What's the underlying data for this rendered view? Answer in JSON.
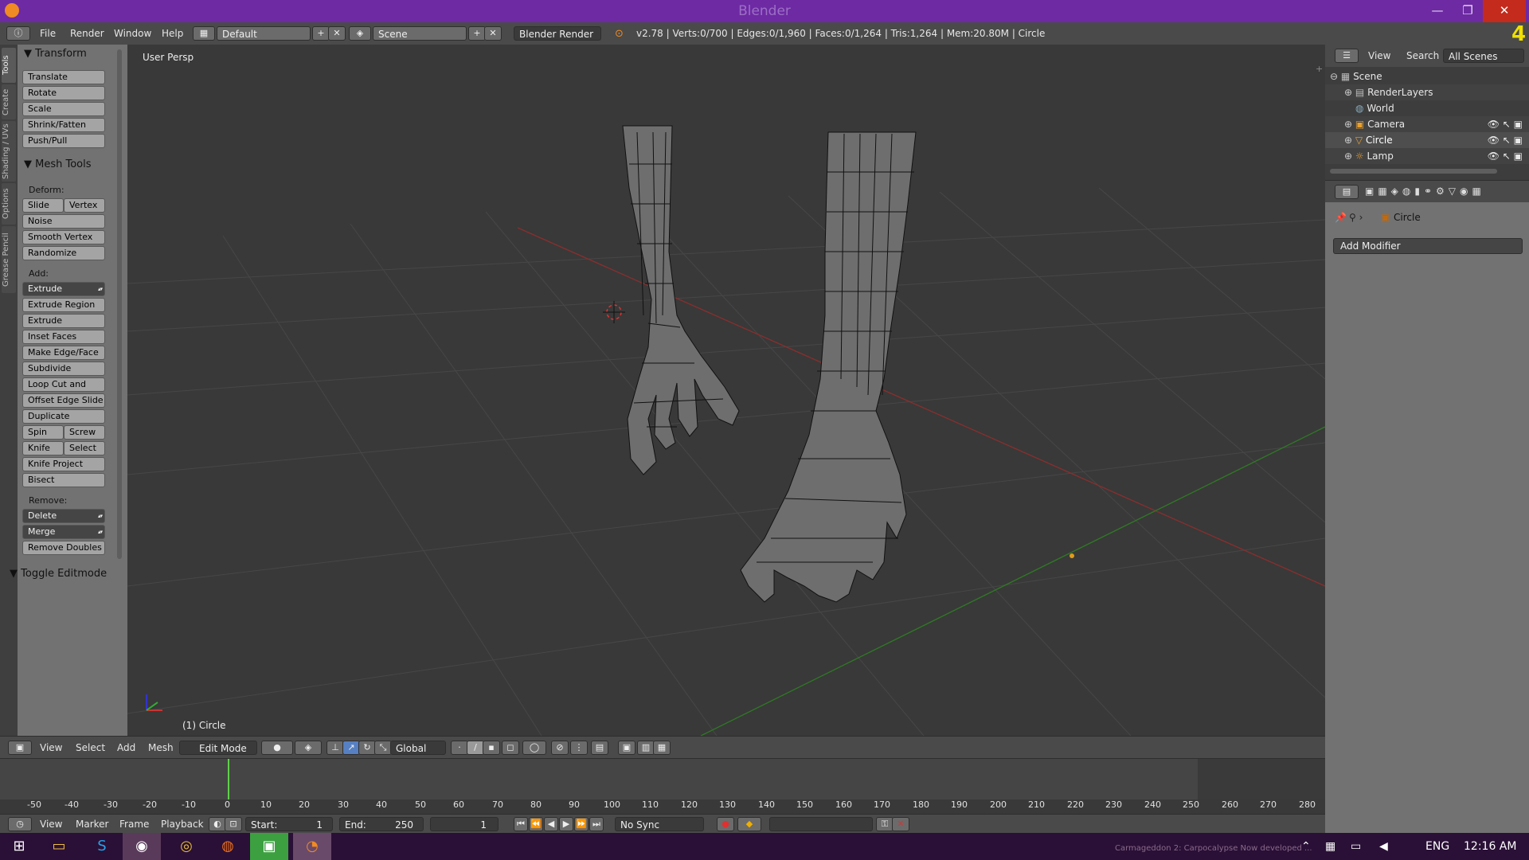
{
  "app": {
    "title": "Blender",
    "version_mark": "4",
    "minimize": "—",
    "maximize": "❐",
    "close": "✕"
  },
  "info_header": {
    "menus": [
      "File",
      "Render",
      "Window",
      "Help"
    ],
    "layout": "Default",
    "scene": "Scene",
    "engine": "Blender Render",
    "stats": "v2.78 | Verts:0/700 | Edges:0/1,960 | Faces:0/1,264 | Tris:1,264 | Mem:20.80M | Circle"
  },
  "vertical_tabs": [
    "Tools",
    "Create",
    "Shading / UVs",
    "Options",
    "Grease Pencil"
  ],
  "tool_shelf": {
    "transform": {
      "header": "Transform",
      "buttons": [
        "Translate",
        "Rotate",
        "Scale",
        "Shrink/Fatten",
        "Push/Pull"
      ]
    },
    "mesh_tools": {
      "header": "Mesh Tools",
      "deform_label": "Deform:",
      "slide_edge": "Slide Ed",
      "vertex": "Vertex",
      "noise": "Noise",
      "smooth_vertex": "Smooth Vertex",
      "randomize": "Randomize",
      "add_label": "Add:",
      "extrude": "Extrude",
      "extrude_region": "Extrude Region",
      "extrude_individual": "Extrude Individual",
      "inset_faces": "Inset Faces",
      "make_edge_face": "Make Edge/Face",
      "subdivide": "Subdivide",
      "loop_cut": "Loop Cut and Slide",
      "offset_edge_slide": "Offset Edge Slide",
      "duplicate": "Duplicate",
      "spin": "Spin",
      "screw": "Screw",
      "knife": "Knife",
      "select": "Select",
      "knife_project": "Knife Project",
      "bisect": "Bisect",
      "remove_label": "Remove:",
      "delete": "Delete",
      "merge": "Merge",
      "remove_doubles": "Remove Doubles"
    },
    "toggle_editmode": "Toggle Editmode"
  },
  "viewport": {
    "label": "User Persp",
    "object_label": "(1) Circle"
  },
  "v3d_header": {
    "menus": [
      "View",
      "Select",
      "Add",
      "Mesh"
    ],
    "mode": "Edit Mode",
    "orientation": "Global"
  },
  "timeline": {
    "ticks": [
      "-50",
      "-40",
      "-30",
      "-20",
      "-10",
      "0",
      "10",
      "20",
      "30",
      "40",
      "50",
      "60",
      "70",
      "80",
      "90",
      "100",
      "110",
      "120",
      "130",
      "140",
      "150",
      "160",
      "170",
      "180",
      "190",
      "200",
      "210",
      "220",
      "230",
      "240",
      "250",
      "260",
      "270",
      "280"
    ],
    "menus": [
      "View",
      "Marker",
      "Frame",
      "Playback"
    ],
    "start": "Start:",
    "start_value": "1",
    "end": "End:",
    "end_value": "250",
    "current": "1",
    "sync": "No Sync"
  },
  "outliner": {
    "menus": [
      "View",
      "Search"
    ],
    "filter": "All Scenes",
    "items": [
      "Scene",
      "RenderLayers",
      "World",
      "Camera",
      "Circle",
      "Lamp"
    ]
  },
  "properties": {
    "object": "Circle",
    "add_modifier": "Add Modifier"
  },
  "taskbar": {
    "watermark": "Carmageddon 2: Carpocalypse Now developed ...",
    "lang": "ENG",
    "time": "12:16 AM"
  },
  "colors": {
    "titlebar": "#6d2aa3",
    "taskbar": "#2a1036",
    "x_axis": "#a33232",
    "y_axis": "#3c8f2b",
    "mesh_fill": "#6e6e6e"
  }
}
